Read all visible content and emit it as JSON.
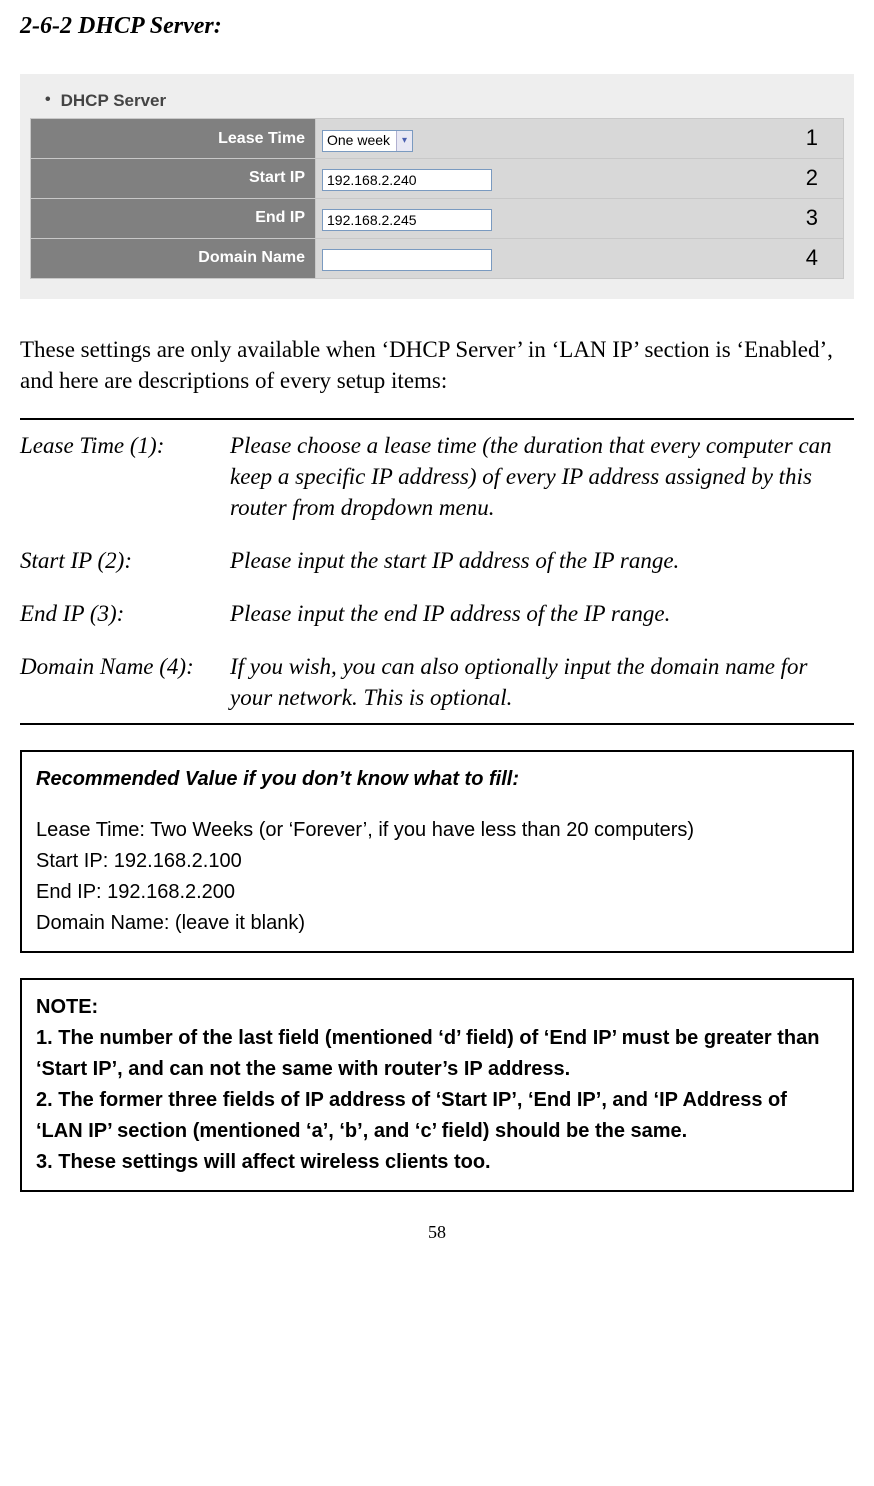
{
  "section_title": "2-6-2 DHCP Server:",
  "panel_header": "DHCP Server",
  "table": {
    "rows": [
      {
        "label": "Lease Time",
        "type": "select",
        "value": "One week"
      },
      {
        "label": "Start IP",
        "type": "text",
        "value": "192.168.2.240"
      },
      {
        "label": "End IP",
        "type": "text",
        "value": "192.168.2.245"
      },
      {
        "label": "Domain Name",
        "type": "text",
        "value": ""
      }
    ]
  },
  "callouts": [
    "1",
    "2",
    "3",
    "4"
  ],
  "intro": "These settings are only available when ‘DHCP Server’ in ‘LAN IP’ section is ‘Enabled’, and here are descriptions of every setup items:",
  "descriptions": [
    {
      "label": "Lease Time (1):",
      "text": "Please choose a lease time (the duration that every computer can keep a specific IP address) of every IP address assigned by this router from dropdown menu."
    },
    {
      "label": "Start IP (2):",
      "text": "Please input the start IP address of the IP range."
    },
    {
      "label": "End IP (3):",
      "text": "Please input the end IP address of the IP range."
    },
    {
      "label": "Domain Name (4):",
      "text": "If you wish, you can also optionally input the domain name for your network. This is optional."
    }
  ],
  "recommended": {
    "title": "Recommended Value if you don’t know what to fill:",
    "lines": [
      "Lease Time: Two Weeks (or ‘Forever’, if you have less than 20 computers)",
      "Start IP: 192.168.2.100",
      "End IP: 192.168.2.200",
      "Domain Name: (leave it blank)"
    ]
  },
  "note": {
    "title": "NOTE:",
    "lines": [
      "1. The number of the last field (mentioned ‘d’ field) of ‘End IP’ must be greater than ‘Start IP’, and can not the same with router’s IP address.",
      "2. The former three fields of IP address of ‘Start IP’, ‘End IP’, and ‘IP Address of ‘LAN IP’ section (mentioned ‘a’, ‘b’, and ‘c’ field) should be the same.",
      "3. These settings will affect wireless clients too."
    ]
  },
  "page_number": "58"
}
